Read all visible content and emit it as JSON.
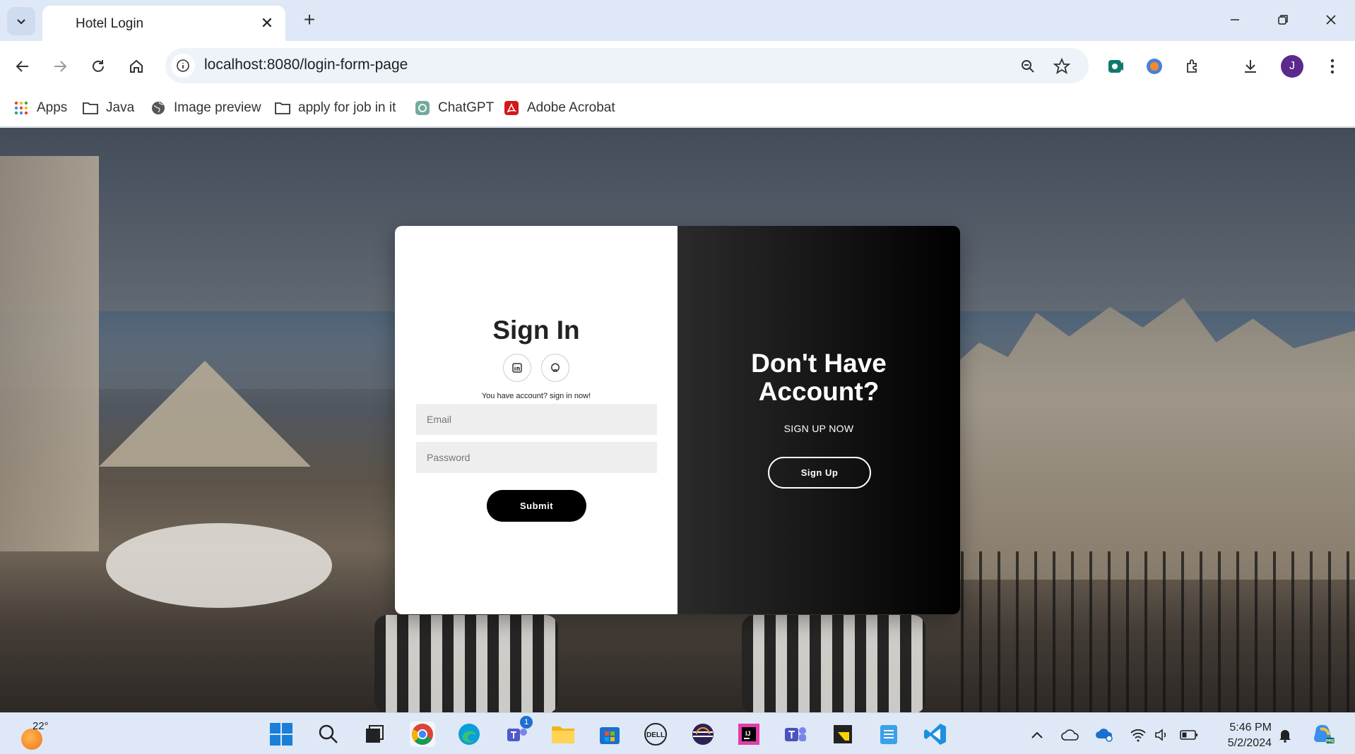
{
  "browser": {
    "tab_title": "Hotel Login",
    "url": "localhost:8080/login-form-page",
    "profile_initial": "J",
    "bookmarks": [
      {
        "label": "Apps",
        "icon": "apps-grid-icon"
      },
      {
        "label": "Java",
        "icon": "folder-icon"
      },
      {
        "label": "Image preview",
        "icon": "globe-icon"
      },
      {
        "label": "apply for job in it",
        "icon": "folder-icon"
      },
      {
        "label": "ChatGPT",
        "icon": "chatgpt-icon"
      },
      {
        "label": "Adobe Acrobat",
        "icon": "acrobat-icon"
      }
    ]
  },
  "signin": {
    "title": "Sign In",
    "social": [
      "linkedin-icon",
      "github-icon"
    ],
    "hint": "You have account? sign in now!",
    "email_placeholder": "Email",
    "password_placeholder": "Password",
    "submit_label": "Submit"
  },
  "signup_panel": {
    "title_line1": "Don't Have",
    "title_line2": "Account?",
    "subtitle": "SIGN UP NOW",
    "button_label": "Sign Up"
  },
  "taskbar": {
    "temperature": "22°",
    "time": "5:46 PM",
    "date": "5/2/2024",
    "teams_badge": "1"
  },
  "colors": {
    "accent_dark": "#000000",
    "card_left_bg": "#ffffff",
    "input_bg": "#eeeeee"
  }
}
